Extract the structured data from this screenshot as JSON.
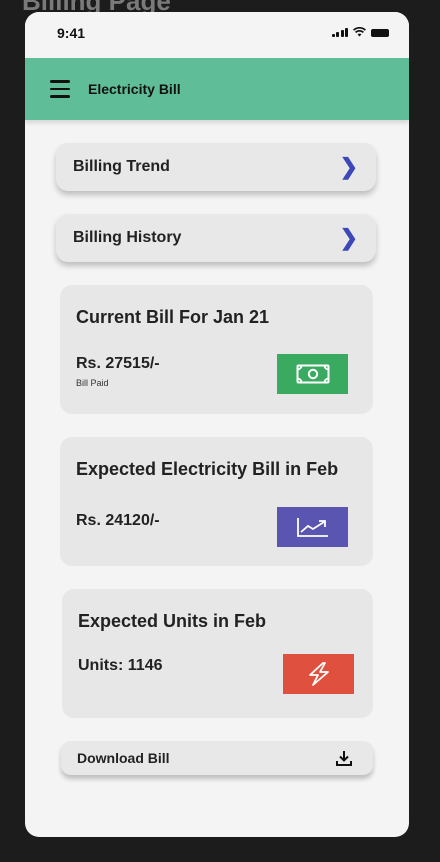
{
  "frame_title": "Billing Page",
  "status_bar": {
    "time": "9:41"
  },
  "header": {
    "title": "Electricity Bill"
  },
  "nav": [
    {
      "label": "Billing Trend"
    },
    {
      "label": "Billing History"
    }
  ],
  "cards": {
    "current": {
      "title": "Current Bill For Jan 21",
      "amount": "Rs. 27515/-",
      "status": "Bill Paid",
      "icon": "cash-icon",
      "color": "#3aaa60"
    },
    "expected_bill": {
      "title": "Expected Electricity Bill in Feb",
      "amount": "Rs. 24120/-",
      "icon": "trend-up-icon",
      "color": "#5a55b0"
    },
    "expected_units": {
      "title": "Expected Units in Feb",
      "units": "Units: 1146",
      "icon": "lightning-icon",
      "color": "#e0503e"
    }
  },
  "download": {
    "label": "Download Bill",
    "icon": "download-icon"
  },
  "colors": {
    "header": "#5fbe98",
    "chevron": "#3d48b8"
  }
}
